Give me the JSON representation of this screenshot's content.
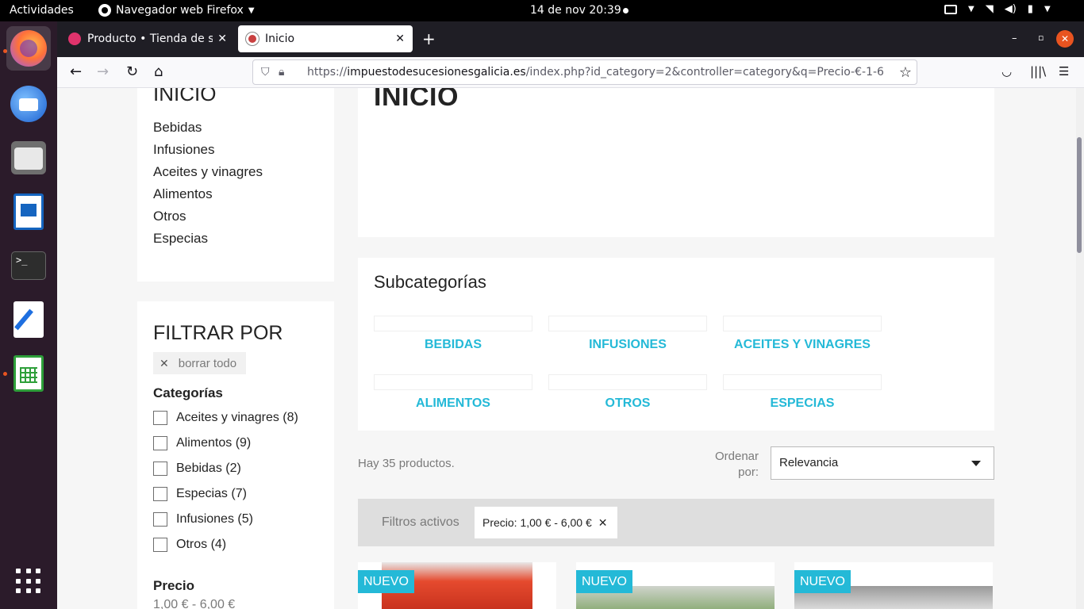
{
  "system": {
    "activities": "Actividades",
    "app_name": "Navegador web Firefox",
    "clock": "14 de nov  20:39"
  },
  "browser": {
    "tabs": [
      {
        "title": "Producto • Tienda de suvenir",
        "favicon_color": "#e0336c"
      },
      {
        "title": "Inicio",
        "favicon_color": "#c94040"
      }
    ],
    "url": {
      "protocol": "https://",
      "host": "impuestodesucesionesgalicia.es",
      "path": "/index.php?id_category=2&controller=category&q=Precio-€-1-6"
    }
  },
  "sidebar": {
    "home_title": "INICIO",
    "categories": [
      "Bebidas",
      "Infusiones",
      "Aceites y vinagres",
      "Alimentos",
      "Otros",
      "Especias"
    ],
    "filter_title": "FILTRAR POR",
    "clear_all": "borrar todo",
    "facet_title": "Categorías",
    "facets": [
      {
        "label": "Aceites y vinagres (8)",
        "checked": false
      },
      {
        "label": "Alimentos (9)",
        "checked": false
      },
      {
        "label": "Bebidas (2)",
        "checked": false
      },
      {
        "label": "Especias (7)",
        "checked": false
      },
      {
        "label": "Infusiones (5)",
        "checked": false
      },
      {
        "label": "Otros (4)",
        "checked": false
      }
    ],
    "price_title": "Precio",
    "price_range": "1,00 € - 6,00 €"
  },
  "main": {
    "title": "INICIO",
    "subcategories_title": "Subcategorías",
    "subcategories": [
      "BEBIDAS",
      "INFUSIONES",
      "ACEITES Y VINAGRES",
      "ALIMENTOS",
      "OTROS",
      "ESPECIAS"
    ],
    "product_count": "Hay 35 productos.",
    "sort_label": "Ordenar por:",
    "sort_value": "Relevancia",
    "active_filters_label": "Filtros activos",
    "active_filter_chip": "Precio: 1,00 € - 6,00 €",
    "products": [
      {
        "badge": "NUEVO"
      },
      {
        "badge": "NUEVO"
      },
      {
        "badge": "NUEVO"
      }
    ]
  },
  "colors": {
    "accent": "#24b9d7",
    "ubuntu_orange": "#e95420"
  }
}
